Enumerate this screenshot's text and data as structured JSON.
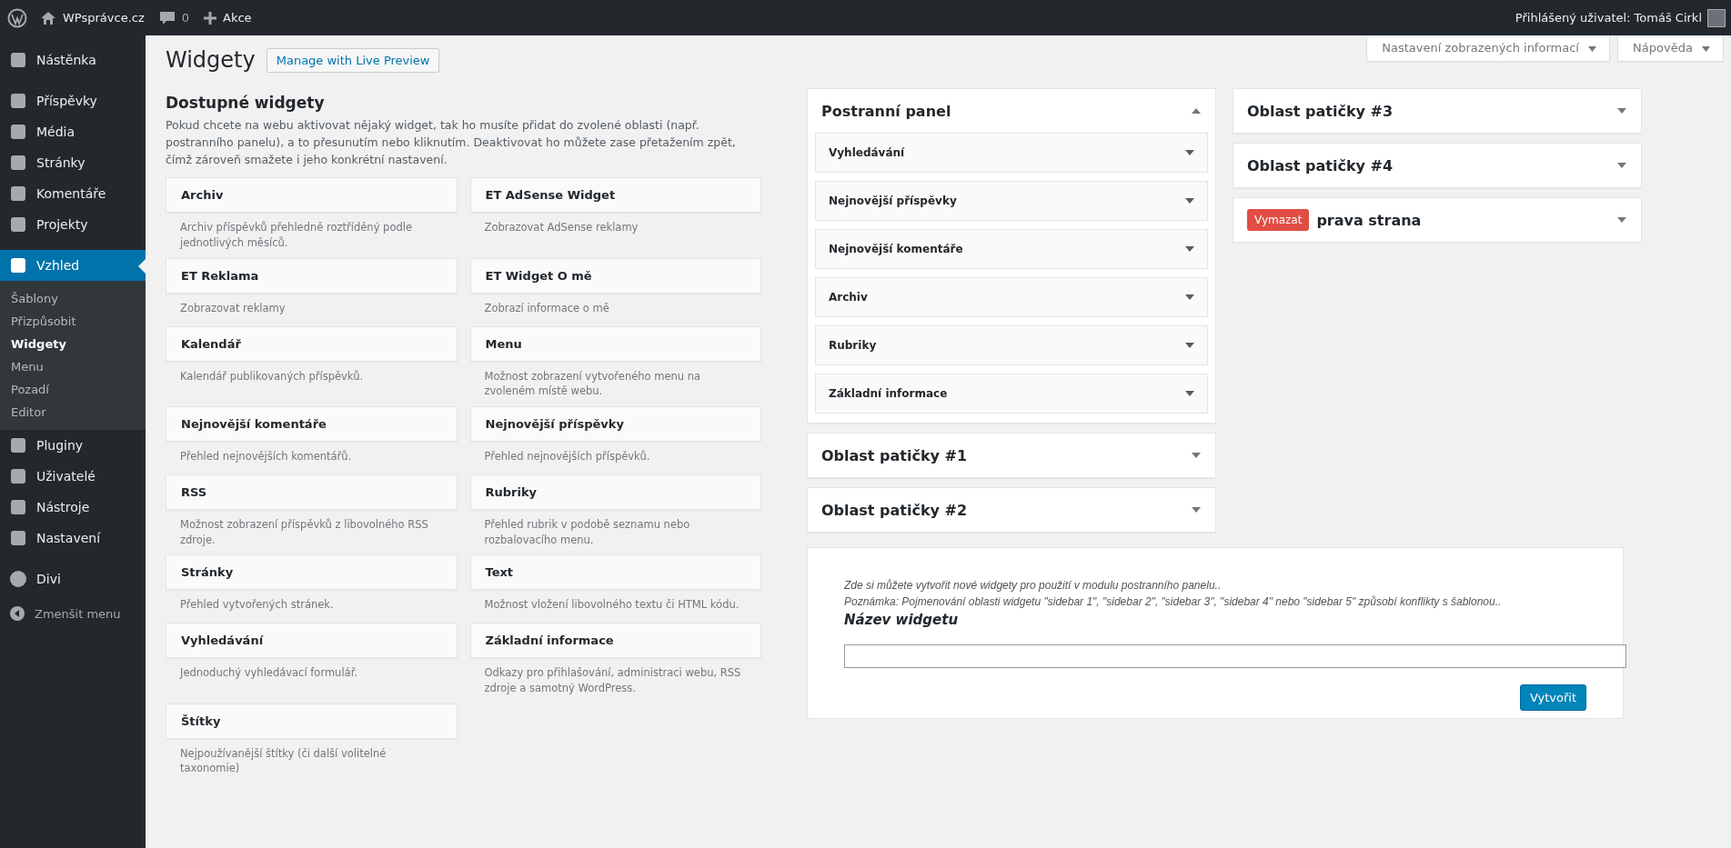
{
  "admin_bar": {
    "site_name": "WPsprávce.cz",
    "comments_count": "0",
    "new_label": "Akce",
    "user_greeting": "Přihlášený uživatel: Tomáš Cirkl"
  },
  "sidebar": {
    "groups": [
      {
        "items": [
          {
            "label": "Nástěnka",
            "selected": false
          }
        ]
      },
      {
        "items": [
          {
            "label": "Příspěvky",
            "selected": false
          },
          {
            "label": "Média",
            "selected": false
          },
          {
            "label": "Stránky",
            "selected": false
          },
          {
            "label": "Komentáře",
            "selected": false
          },
          {
            "label": "Projekty",
            "selected": false
          }
        ]
      },
      {
        "items": [
          {
            "label": "Vzhled",
            "selected": true,
            "children": [
              {
                "label": "Šablony",
                "selected": false
              },
              {
                "label": "Přizpůsobit",
                "selected": false
              },
              {
                "label": "Widgety",
                "selected": true
              },
              {
                "label": "Menu",
                "selected": false
              },
              {
                "label": "Pozadí",
                "selected": false
              },
              {
                "label": "Editor",
                "selected": false
              }
            ]
          },
          {
            "label": "Pluginy",
            "selected": false
          },
          {
            "label": "Uživatelé",
            "selected": false
          },
          {
            "label": "Nástroje",
            "selected": false
          },
          {
            "label": "Nastavení",
            "selected": false
          }
        ]
      },
      {
        "items": [
          {
            "label": "Divi",
            "selected": false
          }
        ]
      }
    ],
    "collapse_label": "Zmenšit menu"
  },
  "screen_meta": [
    "Nastavení zobrazených informací",
    "Nápověda"
  ],
  "page_title": "Widgety",
  "live_preview_button": "Manage with Live Preview",
  "available": {
    "title": "Dostupné widgety",
    "description": "Pokud chcete na webu aktivovat nějaký widget, tak ho musíte přidat do zvolené oblasti (např. postranního panelu), a to přesunutím nebo kliknutím. Deaktivovat ho můžete zase přetažením zpět, čímž zároveň smažete i jeho konkrétní nastavení.",
    "widgets": [
      {
        "name": "Archiv",
        "description": "Archiv příspěvků přehledně roztříděný podle jednotlivých měsíců."
      },
      {
        "name": "ET AdSense Widget",
        "description": "Zobrazovat AdSense reklamy"
      },
      {
        "name": "ET Reklama",
        "description": "Zobrazovat reklamy"
      },
      {
        "name": "ET Widget O mě",
        "description": "Zobrazí informace o mě"
      },
      {
        "name": "Kalendář",
        "description": "Kalendář publikovaných příspěvků."
      },
      {
        "name": "Menu",
        "description": "Možnost zobrazení vytvořeného menu na zvoleném místě webu."
      },
      {
        "name": "Nejnovější komentáře",
        "description": "Přehled nejnovějších komentářů."
      },
      {
        "name": "Nejnovější příspěvky",
        "description": "Přehled nejnovějších příspěvků."
      },
      {
        "name": "RSS",
        "description": "Možnost zobrazení příspěvků z libovolného RSS zdroje."
      },
      {
        "name": "Rubriky",
        "description": "Přehled rubrik v podobě seznamu nebo rozbalovacího menu."
      },
      {
        "name": "Stránky",
        "description": "Přehled vytvořených stránek."
      },
      {
        "name": "Text",
        "description": "Možnost vložení libovolného textu či HTML kódu."
      },
      {
        "name": "Vyhledávání",
        "description": "Jednoduchý vyhledávací formulář."
      },
      {
        "name": "Základní informace",
        "description": "Odkazy pro přihlašování, administraci webu, RSS zdroje a samotný WordPress."
      },
      {
        "name": "Štítky",
        "description": "Nejpoužívanější štítky (či další volitelné taxonomie)"
      }
    ]
  },
  "areas_left": [
    {
      "name": "Postranní panel",
      "expanded": true,
      "widgets": [
        "Vyhledávání",
        "Nejnovější příspěvky",
        "Nejnovější komentáře",
        "Archiv",
        "Rubriky",
        "Základní informace"
      ]
    },
    {
      "name": "Oblast patičky #1",
      "expanded": false
    },
    {
      "name": "Oblast patičky #2",
      "expanded": false
    }
  ],
  "areas_right": [
    {
      "name": "Oblast patičky #3",
      "expanded": false
    },
    {
      "name": "Oblast patičky #4",
      "expanded": false
    },
    {
      "name": "prava strana",
      "expanded": false,
      "delete_label": "Vymazat"
    }
  ],
  "create_form": {
    "hint": "Zde si můžete vytvořit nové widgety pro použití v modulu postranního panelu..",
    "note": "Poznámka: Pojmenování oblasti widgetu \"sidebar 1\", \"sidebar 2\", \"sidebar 3\", \"sidebar 4\" nebo \"sidebar 5\" způsobí konflikty s šablonou..",
    "field_label": "Název widgetu",
    "submit": "Vytvořit"
  }
}
